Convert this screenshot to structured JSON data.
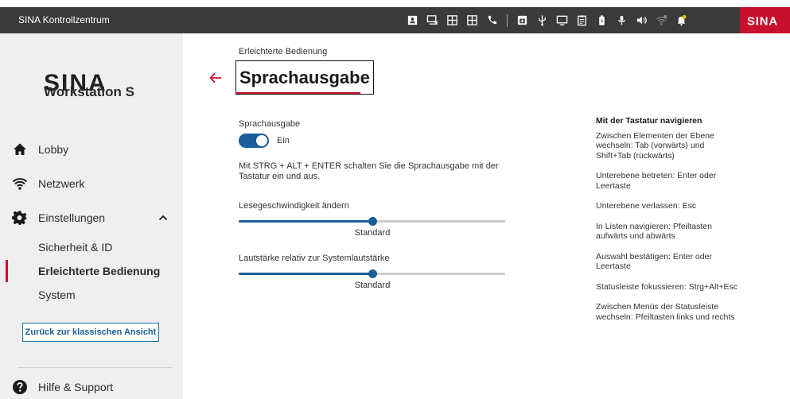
{
  "app": {
    "title": "SINA Kontrollzentrum"
  },
  "tray": {
    "icons": [
      "id-card-icon",
      "remote-desktop-icon",
      "grid-icon",
      "grid-add-icon",
      "phone-icon",
      "app-window-icon",
      "usb-icon",
      "monitor-icon",
      "clipboard-icon",
      "battery-icon",
      "microphone-icon",
      "speaker-icon",
      "wifi-icon",
      "notification-bell-icon"
    ],
    "brand": "SINA"
  },
  "sidebar": {
    "logo_text": "SINA",
    "logo_sub": "Workstation S",
    "items": [
      {
        "label": "Lobby",
        "icon": "home-icon"
      },
      {
        "label": "Netzwerk",
        "icon": "wifi-icon"
      },
      {
        "label": "Einstellungen",
        "icon": "gear-icon"
      }
    ],
    "subitems": [
      {
        "label": "Sicherheit & ID",
        "active": false
      },
      {
        "label": "Erleichterte Bedienung",
        "active": true
      },
      {
        "label": "System",
        "active": false
      }
    ],
    "classic_button": "Zurück zur klassischen Ansicht",
    "help": {
      "label": "Hilfe & Support",
      "icon": "help-circle-icon"
    }
  },
  "main": {
    "breadcrumb": "Erleichterte Bedienung",
    "title": "Sprachausgabe",
    "toggle": {
      "label": "Sprachausgabe",
      "state_label": "Ein",
      "on": true
    },
    "hint": "Mit STRG + ALT + ENTER schalten Sie die Sprachausgabe mit der Tastatur ein und aus.",
    "speed": {
      "label": "Lesegeschwindigkeit ändern",
      "value_fraction": 0.5,
      "caption": "Standard"
    },
    "volume": {
      "label": "Lautstärke relativ zur Systemlautstärke",
      "value_fraction": 0.5,
      "caption": "Standard"
    }
  },
  "keyboard_help": {
    "title": "Mit der Tastatur navigieren",
    "blocks": [
      "Zwischen Elementen der Ebene wechseln: Tab (vorwärts) und Shift+Tab (rückwärts)",
      "Unterebene betreten: Enter oder Leertaste",
      "Unterebene verlassen: Esc",
      "In Listen navigieren: Pfeiltasten aufwärts und abwärts",
      "Auswahl bestätigen: Enter oder Leertaste",
      "Statusleiste fokussieren: Strg+Alt+Esc",
      "Zwischen Menüs der Statusleiste wechseln: Pfeiltasten links und rechts"
    ]
  },
  "colors": {
    "accent": "#c8102e",
    "primary": "#1b5e9a",
    "sidebar_bg": "#efefef",
    "topbar_bg": "#3a3a3a"
  }
}
